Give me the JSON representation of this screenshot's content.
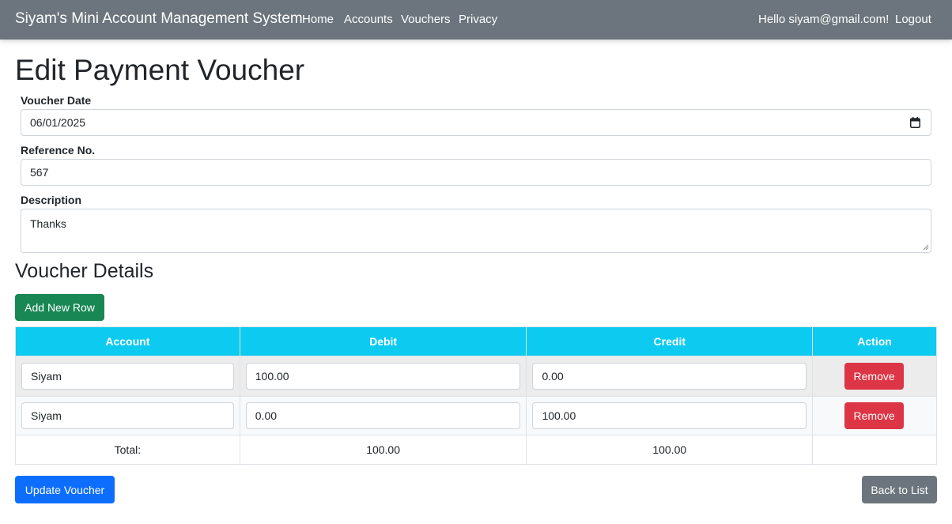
{
  "navbar": {
    "brand": "Siyam's Mini Account Management System",
    "links": [
      "Home",
      "Accounts",
      "Vouchers",
      "Privacy"
    ],
    "greeting": "Hello siyam@gmail.com!",
    "logout": "Logout",
    "background": "#6c757d"
  },
  "page": {
    "title": "Edit Payment Voucher"
  },
  "form": {
    "date_label": "Voucher Date",
    "date_value": "06/01/2025",
    "reference_label": "Reference No.",
    "reference_value": "567",
    "description_label": "Description",
    "description_value": "Thanks"
  },
  "details": {
    "title": "Voucher Details",
    "add_row_label": "Add New Row",
    "columns": [
      "Account",
      "Debit",
      "Credit",
      "Action"
    ],
    "rows": [
      {
        "account": "Siyam",
        "debit": "100.00",
        "credit": "0.00",
        "action": "Remove"
      },
      {
        "account": "Siyam",
        "debit": "0.00",
        "credit": "100.00",
        "action": "Remove"
      }
    ],
    "total": {
      "label": "Total:",
      "debit": "100.00",
      "credit": "100.00"
    }
  },
  "actions": {
    "update_label": "Update Voucher",
    "back_label": "Back to List"
  },
  "colors": {
    "header_cyan": "#0dcaf0",
    "add_green": "#198754",
    "update_blue": "#0d6efd",
    "remove_red": "#dc3545",
    "back_gray": "#6c757d"
  },
  "icons": {
    "date_picker": "calendar-icon"
  }
}
